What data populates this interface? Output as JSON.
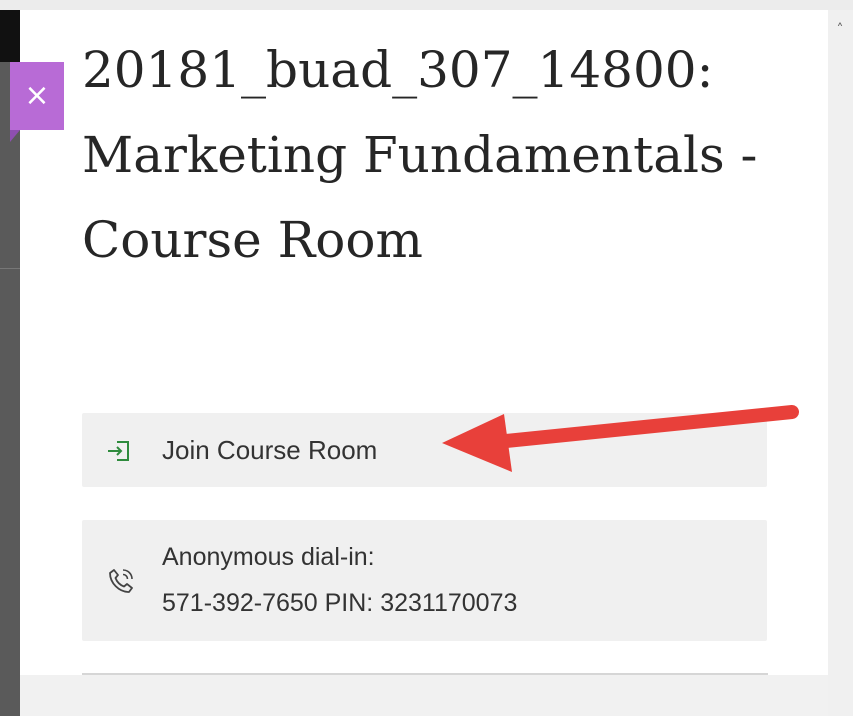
{
  "panel": {
    "title": "20181_buad_307_14800: Marketing Fundamentals - Course Room",
    "close_icon": "close-icon",
    "close_glyph": "×",
    "scroll_up_glyph": "˄",
    "accent_color": "#b86bd6"
  },
  "join": {
    "icon": "enter-room-icon",
    "label": "Join Course Room"
  },
  "dial_in": {
    "icon": "phone-icon",
    "label": "Anonymous dial-in:",
    "number_line": "571-392-7650 PIN: 3231170073"
  },
  "annotation": {
    "arrow_color": "#e8403a",
    "points_to": "join-course-room-button"
  }
}
